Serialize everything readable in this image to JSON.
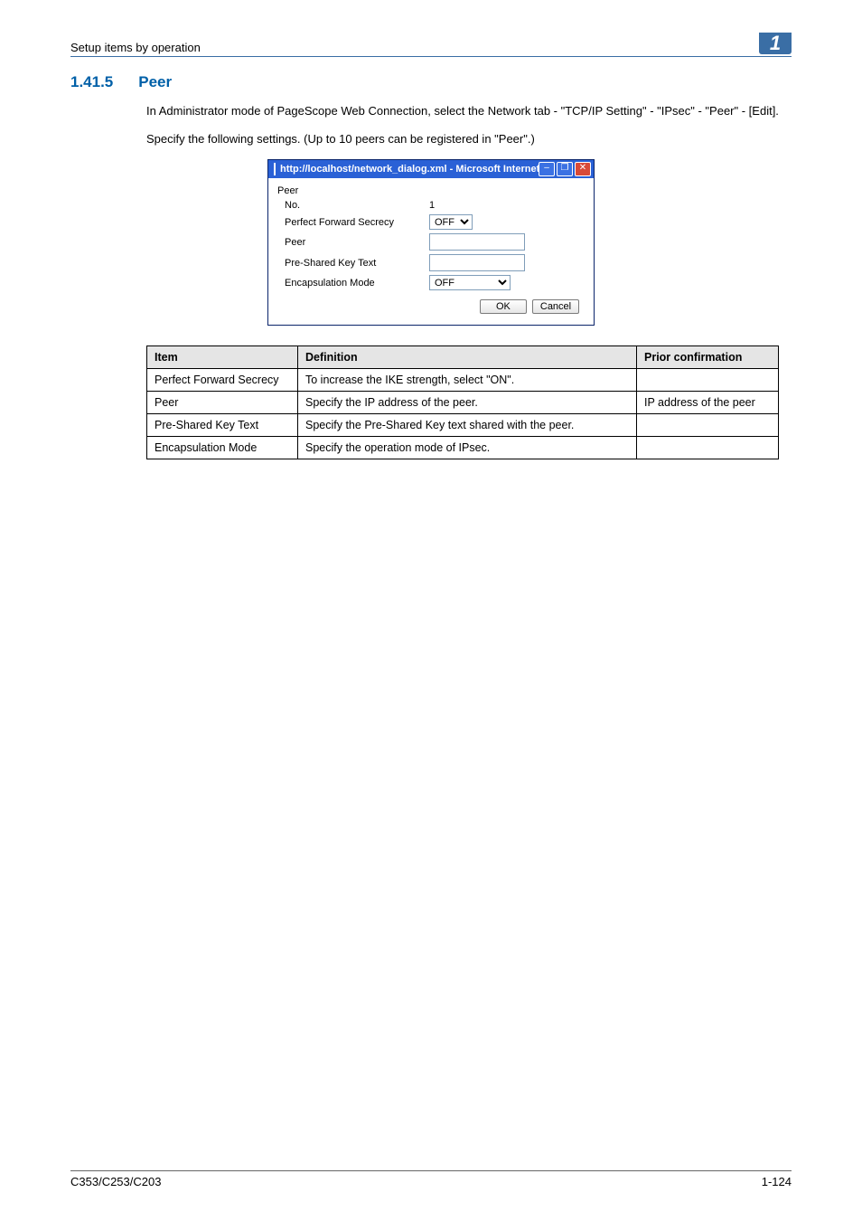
{
  "header": {
    "subtitle": "Setup items by operation",
    "chapter": "1"
  },
  "section": {
    "number": "1.41.5",
    "title": "Peer",
    "intro1": "In Administrator mode of PageScope Web Connection, select the Network tab - \"TCP/IP Setting\" - \"IPsec\" - \"Peer\" - [Edit].",
    "intro2": "Specify the following settings. (Up to 10 peers can be registered in \"Peer\".)"
  },
  "dialog": {
    "title": "http://localhost/network_dialog.xml - Microsoft Internet Explorer",
    "heading": "Peer",
    "labels": {
      "no": "No.",
      "pfs": "Perfect Forward Secrecy",
      "peer": "Peer",
      "psk": "Pre-Shared Key Text",
      "enc": "Encapsulation Mode"
    },
    "values": {
      "no": "1",
      "pfs": "OFF",
      "peer": "",
      "psk": "",
      "enc": "OFF"
    },
    "buttons": {
      "ok": "OK",
      "cancel": "Cancel"
    }
  },
  "table": {
    "headers": {
      "item": "Item",
      "definition": "Definition",
      "prior": "Prior confirmation"
    },
    "rows": [
      {
        "item": "Perfect Forward Secrecy",
        "definition": "To increase the IKE strength, select \"ON\".",
        "prior": ""
      },
      {
        "item": "Peer",
        "definition": "Specify the IP address of the peer.",
        "prior": "IP address of the peer"
      },
      {
        "item": "Pre-Shared Key Text",
        "definition": "Specify the Pre-Shared Key text shared with the peer.",
        "prior": ""
      },
      {
        "item": "Encapsulation Mode",
        "definition": "Specify the operation mode of IPsec.",
        "prior": ""
      }
    ]
  },
  "footer": {
    "model": "C353/C253/C203",
    "page": "1-124"
  }
}
